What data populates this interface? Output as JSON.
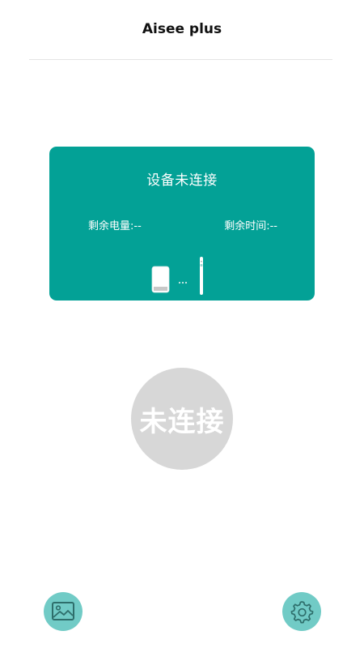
{
  "header": {
    "title": "Aisee plus"
  },
  "device_card": {
    "status_text": "设备未连接",
    "battery_label": "剩余电量:--",
    "time_label": "剩余时间:--",
    "illustration_icon": "device-pen-icon",
    "card_color": "#03a196"
  },
  "connect_button": {
    "label": "未连接",
    "background": "#d7d7d7"
  },
  "bottom_bar": {
    "gallery_icon": "image-gallery-icon",
    "settings_icon": "gear-icon",
    "button_color": "#71cbc6"
  }
}
